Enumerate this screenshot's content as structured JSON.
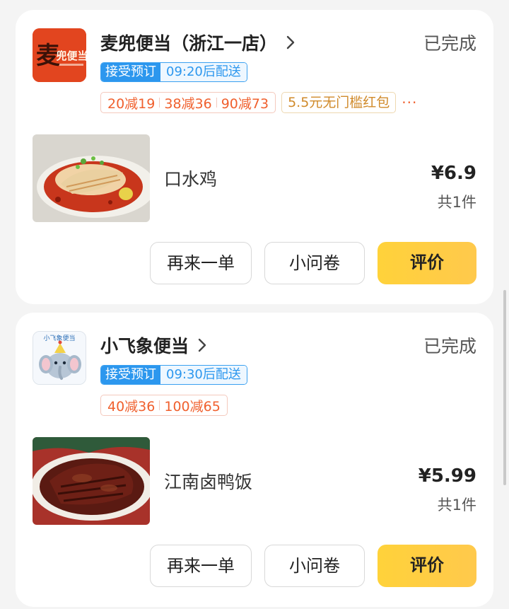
{
  "orders": [
    {
      "shop_name": "麦兜便当（浙江一店）",
      "logo_text": "麦兜便当",
      "status": "已完成",
      "delivery_badge": "接受预订",
      "delivery_time": "09:20后配送",
      "discounts": [
        "20减19",
        "38减36",
        "90减73"
      ],
      "coupon": "5.5元无门槛红包",
      "more": "···",
      "dish_name": "口水鸡",
      "dish_image": "chicken-dish",
      "price": "¥6.9",
      "quantity": "共1件",
      "actions": {
        "reorder": "再来一单",
        "survey": "小问卷",
        "review": "评价"
      }
    },
    {
      "shop_name": "小飞象便当",
      "logo_text": "小飞象便当",
      "status": "已完成",
      "delivery_badge": "接受预订",
      "delivery_time": "09:30后配送",
      "discounts": [
        "40减36",
        "100减65"
      ],
      "dish_name": "江南卤鸭饭",
      "dish_image": "braised-duck-dish",
      "price": "¥5.99",
      "quantity": "共1件",
      "actions": {
        "reorder": "再来一单",
        "survey": "小问卷",
        "review": "评价"
      }
    }
  ],
  "colors": {
    "primary_button": "#ffd23a",
    "discount_red": "#f0602e",
    "delivery_blue": "#2c97ee",
    "coupon_gold": "#d08a2a"
  }
}
